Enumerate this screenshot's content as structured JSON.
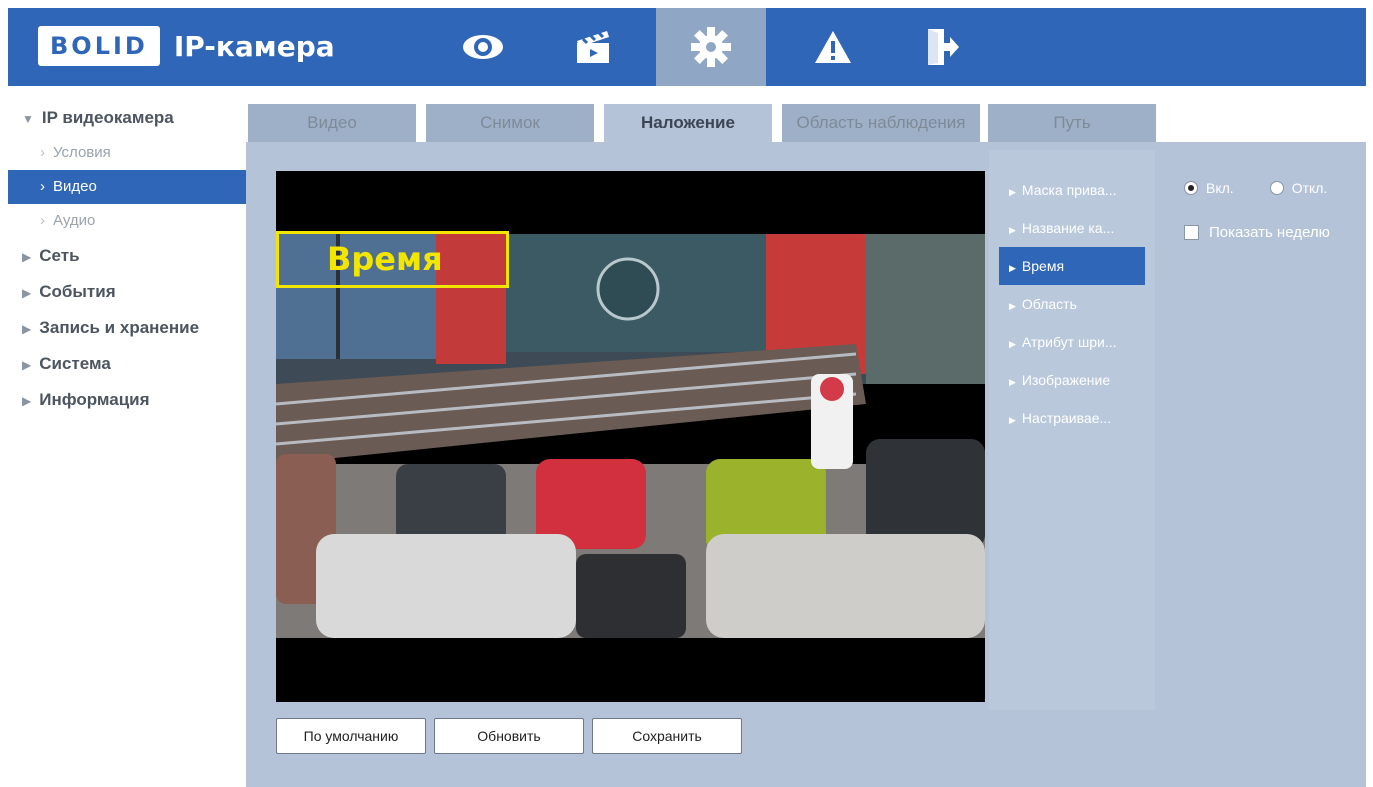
{
  "header": {
    "logo_text": "BOLID",
    "title": "IP-камера",
    "nav": [
      {
        "icon": "eye-icon"
      },
      {
        "icon": "clapperboard-icon"
      },
      {
        "icon": "gear-icon",
        "active": true
      },
      {
        "icon": "warning-icon"
      },
      {
        "icon": "exit-icon"
      }
    ],
    "colors": {
      "bar": "#2f66b8",
      "active": "#8fa7c5"
    }
  },
  "sidebar": {
    "sections": [
      {
        "label": "IP видеокамера",
        "expanded": true
      },
      {
        "label": "Сеть"
      },
      {
        "label": "События"
      },
      {
        "label": "Запись и хранение"
      },
      {
        "label": "Система"
      },
      {
        "label": "Информация"
      }
    ],
    "subitems": [
      {
        "label": "Условия"
      },
      {
        "label": "Видео",
        "selected": true
      },
      {
        "label": "Аудио"
      }
    ]
  },
  "tabs": [
    {
      "label": "Видео"
    },
    {
      "label": "Снимок"
    },
    {
      "label": "Наложение",
      "active": true
    },
    {
      "label": "Область наблюдения"
    },
    {
      "label": "Путь"
    }
  ],
  "video": {
    "overlay_label": "Время"
  },
  "submenu": [
    {
      "label": "Маска прива..."
    },
    {
      "label": "Название ка..."
    },
    {
      "label": "Время",
      "active": true
    },
    {
      "label": "Область"
    },
    {
      "label": "Атрибут шри..."
    },
    {
      "label": "Изображение"
    },
    {
      "label": "Настраивае..."
    }
  ],
  "options": {
    "on_label": "Вкл.",
    "off_label": "Откл.",
    "selected": "on",
    "show_week_label": "Показать неделю",
    "show_week_checked": false
  },
  "buttons": {
    "default_label": "По умолчанию",
    "refresh_label": "Обновить",
    "save_label": "Сохранить"
  }
}
